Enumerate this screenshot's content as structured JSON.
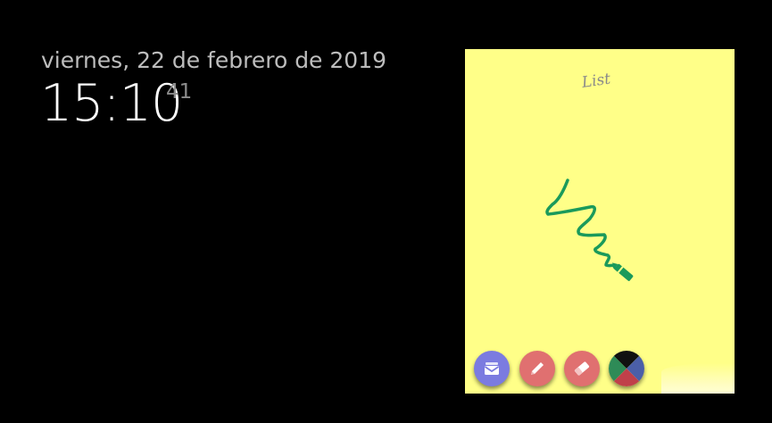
{
  "clock": {
    "date": "viernes, 22 de febrero de 2019",
    "time": "15:10",
    "seconds": "41"
  },
  "note": {
    "background": "#ffff88",
    "title": "List",
    "stroke_color": "#1a9a5b"
  },
  "toolbar": {
    "buttons": [
      {
        "name": "notes-button",
        "icon": "envelope-stack-icon",
        "color": "#7b7be0"
      },
      {
        "name": "pen-button",
        "icon": "pencil-icon",
        "color": "#e07070"
      },
      {
        "name": "eraser-button",
        "icon": "eraser-icon",
        "color": "#e07070"
      },
      {
        "name": "color-picker-button",
        "icon": "color-quadrant-icon",
        "colors": [
          "#111111",
          "#2e8b57",
          "#4b5fa8",
          "#c0404a"
        ]
      }
    ]
  }
}
